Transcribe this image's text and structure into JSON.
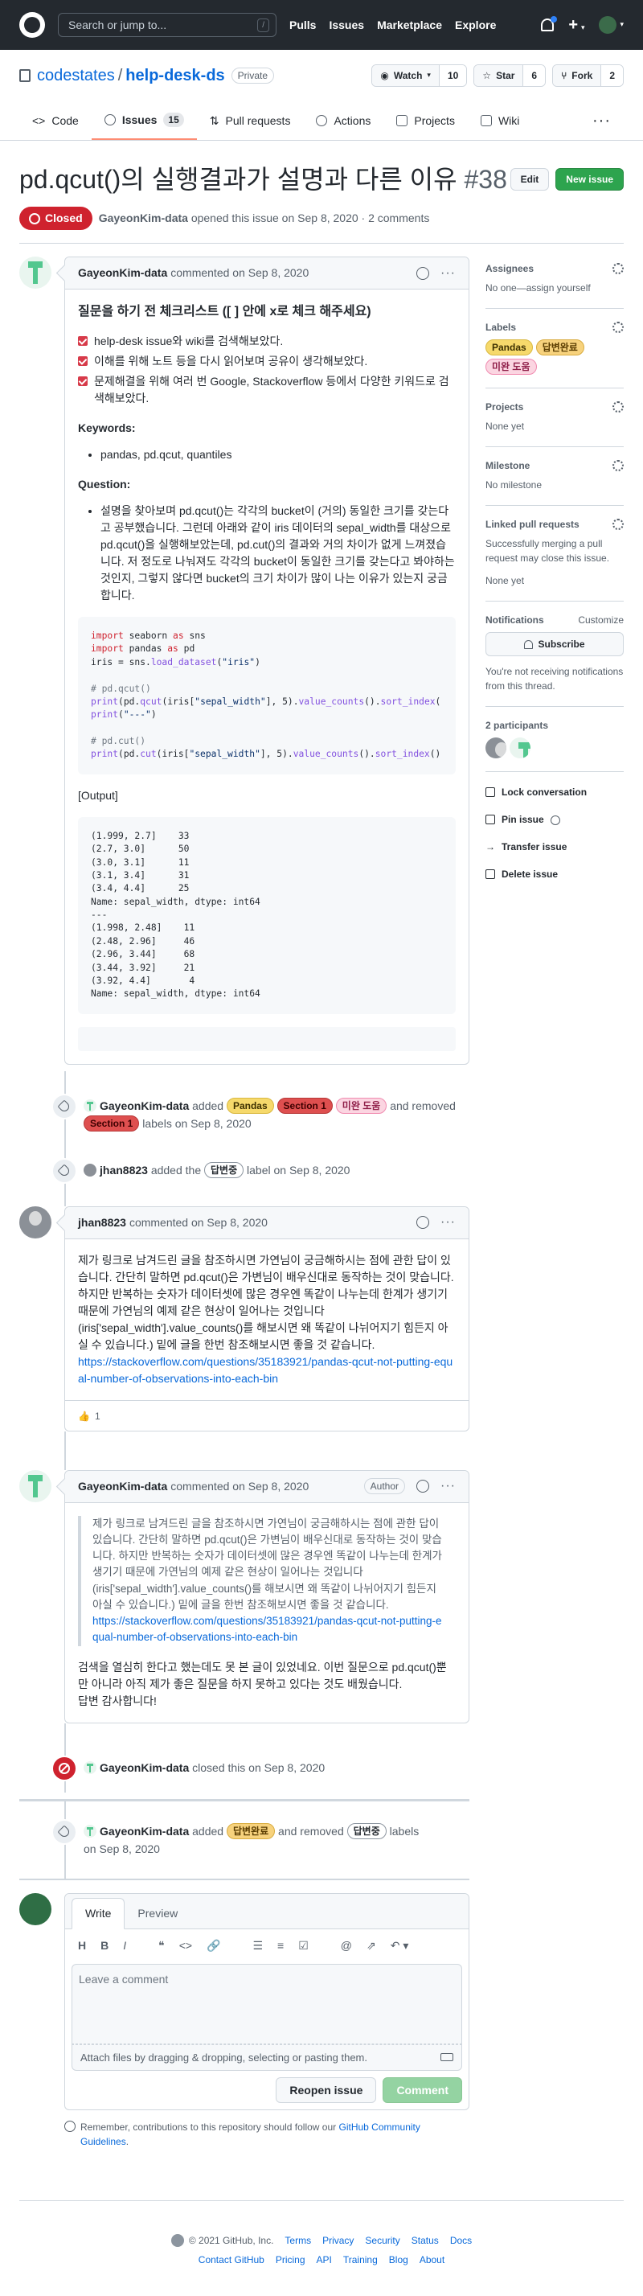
{
  "header": {
    "search_placeholder": "Search or jump to...",
    "search_key": "/",
    "nav": [
      "Pulls",
      "Issues",
      "Marketplace",
      "Explore"
    ]
  },
  "repo": {
    "owner": "codestates",
    "name": "help-desk-ds",
    "visibility": "Private",
    "watch_label": "Watch",
    "watch_count": "10",
    "star_label": "Star",
    "star_count": "6",
    "fork_label": "Fork",
    "fork_count": "2",
    "tabs": {
      "code": "Code",
      "issues": "Issues",
      "issues_count": "15",
      "pulls": "Pull requests",
      "actions": "Actions",
      "projects": "Projects",
      "wiki": "Wiki"
    }
  },
  "issue": {
    "title": "pd.qcut()의 실행결과가 설명과 다른 이유",
    "number": "#38",
    "edit_label": "Edit",
    "new_issue_label": "New issue",
    "state": "Closed",
    "author": "GayeonKim-data",
    "meta": "opened this issue on Sep 8, 2020 · 2 comments"
  },
  "colors": {
    "closed": "#cf222e",
    "green": "#2da44e",
    "link": "#0969da"
  },
  "first_comment": {
    "author": "GayeonKim-data",
    "action": "commented on Sep 8, 2020",
    "heading": "질문을 하기 전 체크리스트 ([ ] 안에 x로 체크 해주세요)",
    "tasks": [
      "help-desk issue와 wiki를 검색해보았다.",
      "이해를 위해 노트 등을 다시 읽어보며 공유이 생각해보았다.",
      "문제해결을 위해 여러 번 Google, Stackoverflow 등에서 다양한 키워드로 검색해보았다."
    ],
    "keywords_label": "Keywords:",
    "keywords": "pandas, pd.qcut, quantiles",
    "question_label": "Question:",
    "question": "설명을 찾아보며 pd.qcut()는 각각의 bucket이 (거의) 동일한 크기를 갖는다고 공부했습니다. 그런데 아래와 같이 iris 데이터의 sepal_width를 대상으로 pd.qcut()을 실행해보았는데, pd.cut()의 결과와 거의 차이가 없게 느껴졌습니다. 저 정도로 나눠져도 각각의 bucket이 동일한 크기를 갖는다고 봐야하는 것인지, 그렇지 않다면 bucket의 크기 차이가 많이 나는 이유가 있는지 궁금합니다.",
    "output_label": "[Output]"
  },
  "events": {
    "labels_added": {
      "actor": "GayeonKim-data",
      "added": "added",
      "and_removed": "and removed",
      "labels_on": "labels on Sep 8, 2020",
      "pandas": "Pandas",
      "section1": "Section 1",
      "unanswered": "미완 도움",
      "removed_label": "Section 1"
    },
    "jhan_label": {
      "actor": "jhan8823",
      "text_before": "added the",
      "label": "답변중",
      "text_after": "label on Sep 8, 2020"
    },
    "closed": {
      "actor": "GayeonKim-data",
      "text": "closed this on Sep 8, 2020"
    },
    "final_labels": {
      "actor": "GayeonKim-data",
      "added": "added",
      "label_added": "답변완료",
      "and_removed": "and removed",
      "label_removed": "답변중",
      "labels": "labels",
      "date": "on Sep 8, 2020"
    }
  },
  "jhan_comment": {
    "author": "jhan8823",
    "action": "commented on Sep 8, 2020",
    "body": "제가 링크로 남겨드린 글을 참조하시면 가연님이 궁금해하시는 점에 관한 답이 있습니다. 간단히 말하면 pd.qcut()은 가변님이 배우신대로 동작하는 것이 맞습니다. 하지만 반복하는 숫자가 데이터셋에 많은 경우엔 똑같이 나누는데 한계가 생기기 때문에 가연님의 예제 같은 현상이 일어나는 것입니다 (iris['sepal_width'].value_counts()를 해보시면 왜 똑같이 나뉘어지기 힘든지 아실 수 있습니다.) 밑에 글을 한번 참조해보시면 좋을 것 같습니다.",
    "link": "https://stackoverflow.com/questions/35183921/pandas-qcut-not-putting-equal-number-of-observations-into-each-bin",
    "reaction_emoji": "👍",
    "reaction_count": "1"
  },
  "reply_comment": {
    "author": "GayeonKim-data",
    "action": "commented on Sep 8, 2020",
    "badge": "Author",
    "quote": "제가 링크로 남겨드린 글을 참조하시면 가연님이 궁금해하시는 점에 관한 답이 있습니다. 간단히 말하면 pd.qcut()은 가변님이 배우신대로 동작하는 것이 맞습니다. 하지만 반복하는 숫자가 데이터셋에 많은 경우엔 똑같이 나누는데 한계가 생기기 때문에 가연님의 예제 같은 현상이 일어나는 것입니다 (iris['sepal_width'].value_counts()를 해보시면 왜 똑같이 나뉘어지기 힘든지 아실 수 있습니다.) 밑에 글을 한번 참조해보시면 좋을 것 같습니다.",
    "quote_link": "https://stackoverflow.com/questions/35183921/pandas-qcut-not-putting-equal-number-of-observations-into-each-bin",
    "body1": "검색을 열심히 한다고 했는데도 못 본 글이 있었네요. 이번 질문으로 pd.qcut()뿐만 아니라 아직 제가 좋은 질문을 하지 못하고 있다는 것도 배웠습니다.",
    "body2": "답변 감사합니다!"
  },
  "editor": {
    "write_tab": "Write",
    "preview_tab": "Preview",
    "placeholder": "Leave a comment",
    "attach_text": "Attach files by dragging & dropping, selecting or pasting them.",
    "reopen_label": "Reopen issue",
    "comment_label": "Comment",
    "remember_text": "Remember, contributions to this repository should follow our",
    "guidelines_link": "GitHub Community Guidelines",
    "remember_end": "."
  },
  "sidebar": {
    "assignees_title": "Assignees",
    "assignees_value": "No one—assign yourself",
    "labels_title": "Labels",
    "label_pandas": "Pandas",
    "label_answered": "답변완료",
    "label_unanswered": "미완 도움",
    "projects_title": "Projects",
    "projects_value": "None yet",
    "milestone_title": "Milestone",
    "milestone_value": "No milestone",
    "linked_title": "Linked pull requests",
    "linked_desc": "Successfully merging a pull request may close this issue.",
    "linked_value": "None yet",
    "notifications_title": "Notifications",
    "customize": "Customize",
    "subscribe_label": "Subscribe",
    "notif_desc": "You're not receiving notifications from this thread.",
    "participants_title": "2 participants",
    "lock_label": "Lock conversation",
    "pin_label": "Pin issue",
    "transfer_label": "Transfer issue",
    "delete_label": "Delete issue"
  },
  "footer": {
    "copyright": "© 2021 GitHub, Inc.",
    "links_row1": [
      "Terms",
      "Privacy",
      "Security",
      "Status",
      "Docs"
    ],
    "links_row2": [
      "Contact GitHub",
      "Pricing",
      "API",
      "Training",
      "Blog",
      "About"
    ]
  }
}
